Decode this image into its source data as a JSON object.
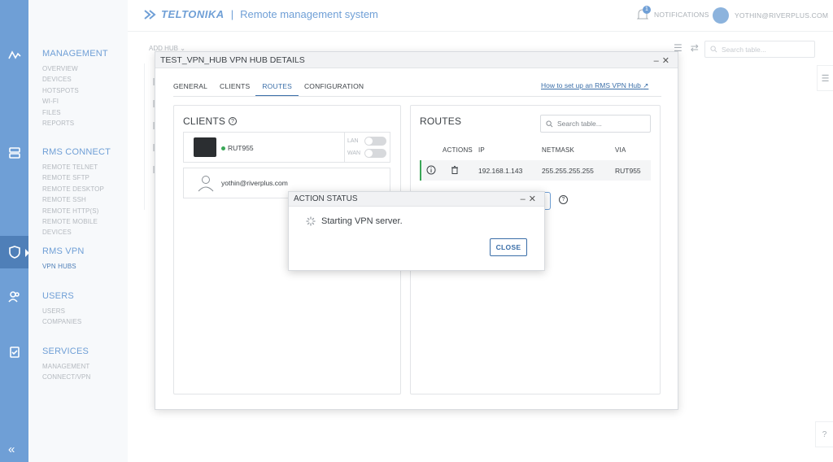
{
  "brand": {
    "logo": "TELTONIKA",
    "separator": "|",
    "title": "Remote management system"
  },
  "topbar": {
    "notifications_label": "NOTIFICATIONS",
    "notifications_count": "1",
    "user_label": "YOTHIN@RIVERPLUS.COM"
  },
  "menu": {
    "management": {
      "title": "MANAGEMENT",
      "items": [
        "OVERVIEW",
        "DEVICES",
        "HOTSPOTS",
        "WI-FI",
        "FILES",
        "REPORTS"
      ]
    },
    "rms_connect": {
      "title": "RMS CONNECT",
      "items": [
        "REMOTE TELNET",
        "REMOTE SFTP",
        "REMOTE DESKTOP",
        "REMOTE SSH",
        "REMOTE HTTP(S)",
        "REMOTE MOBILE DEVICES"
      ]
    },
    "rms_vpn": {
      "title": "RMS VPN",
      "items": [
        "VPN HUBS"
      ]
    },
    "users": {
      "title": "USERS",
      "items": [
        "USERS",
        "COMPANIES"
      ]
    },
    "services": {
      "title": "SERVICES",
      "items": [
        "MANAGEMENT",
        "CONNECT/VPN"
      ]
    }
  },
  "background": {
    "add_hub": "ADD HUB",
    "search_placeholder": "Search table..."
  },
  "dialog": {
    "title": "TEST_VPN_HUB VPN HUB DETAILS",
    "tabs": [
      "GENERAL",
      "CLIENTS",
      "ROUTES",
      "CONFIGURATION"
    ],
    "active_tab": "ROUTES",
    "howto_link": "How to set up an RMS VPN Hub",
    "clients": {
      "title": "CLIENTS",
      "device": {
        "name": "RUT955",
        "status_color": "#3aa757",
        "lan_label": "LAN",
        "wan_label": "WAN",
        "lan_on": false,
        "wan_on": false
      },
      "user_email": "yothin@riverplus.com"
    },
    "routes": {
      "title": "ROUTES",
      "search_placeholder": "Search table...",
      "columns": [
        "ACTIONS",
        "IP",
        "NETMASK",
        "VIA"
      ],
      "rows": [
        {
          "ip": "192.168.1.143",
          "netmask": "255.255.255.255",
          "via": "RUT955"
        }
      ]
    }
  },
  "action_status": {
    "title": "ACTION STATUS",
    "message": "Starting VPN server.",
    "close_label": "CLOSE"
  },
  "colors": {
    "accent": "#6f9fd6",
    "link": "#3a6ea8",
    "online": "#3aa757"
  }
}
